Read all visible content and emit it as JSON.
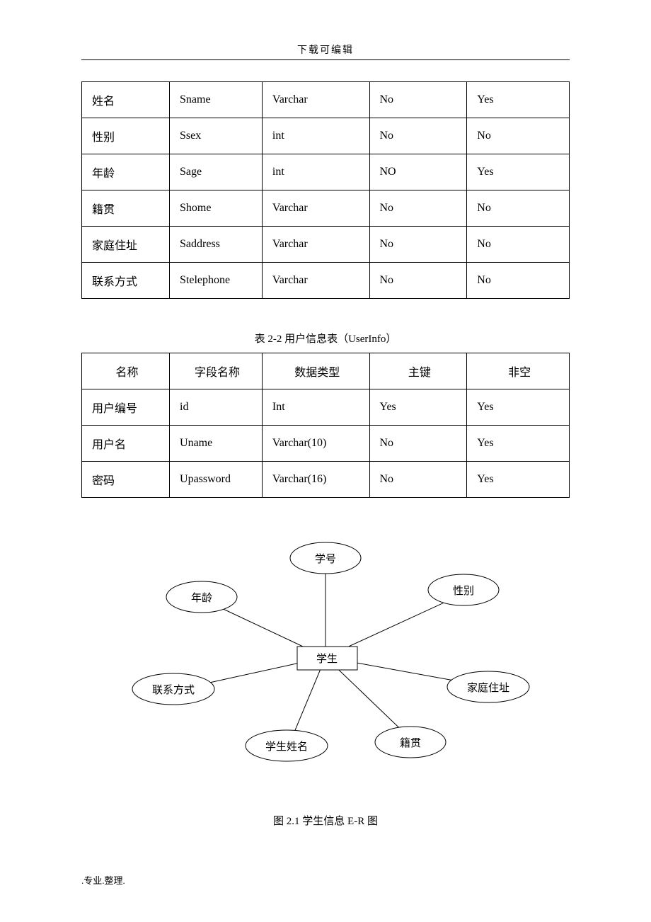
{
  "header": "下载可编辑",
  "table1": {
    "rows": [
      {
        "c0": "姓名",
        "c1": "Sname",
        "c2": "Varchar",
        "c3": "No",
        "c4": "Yes"
      },
      {
        "c0": "性别",
        "c1": "Ssex",
        "c2": "int",
        "c3": "No",
        "c4": "No"
      },
      {
        "c0": "年龄",
        "c1": "Sage",
        "c2": "int",
        "c3": "NO",
        "c4": "Yes"
      },
      {
        "c0": "籍贯",
        "c1": "Shome",
        "c2": "Varchar",
        "c3": "No",
        "c4": "No"
      },
      {
        "c0": "家庭住址",
        "c1": "Saddress",
        "c2": "Varchar",
        "c3": "No",
        "c4": "No"
      },
      {
        "c0": "联系方式",
        "c1": "Stelephone",
        "c2": "Varchar",
        "c3": "No",
        "c4": "No"
      }
    ]
  },
  "table2": {
    "caption": "表 2-2  用户信息表（UserInfo）",
    "headers": {
      "c0": "名称",
      "c1": "字段名称",
      "c2": "数据类型",
      "c3": "主键",
      "c4": "非空"
    },
    "rows": [
      {
        "c0": "用户编号",
        "c1": "id",
        "c2": "Int",
        "c3": "Yes",
        "c4": "Yes"
      },
      {
        "c0": "用户名",
        "c1": "Uname",
        "c2": "Varchar(10)",
        "c3": "No",
        "c4": "Yes"
      },
      {
        "c0": "密码",
        "c1": "Upassword",
        "c2": "Varchar(16)",
        "c3": "No",
        "c4": "Yes"
      }
    ]
  },
  "diagram": {
    "entity": "学生",
    "attributes": [
      "学号",
      "性别",
      "家庭住址",
      "籍贯",
      "学生姓名",
      "联系方式",
      "年龄"
    ],
    "caption": "图 2.1  学生信息 E-R 图"
  },
  "footer": ".专业.整理."
}
